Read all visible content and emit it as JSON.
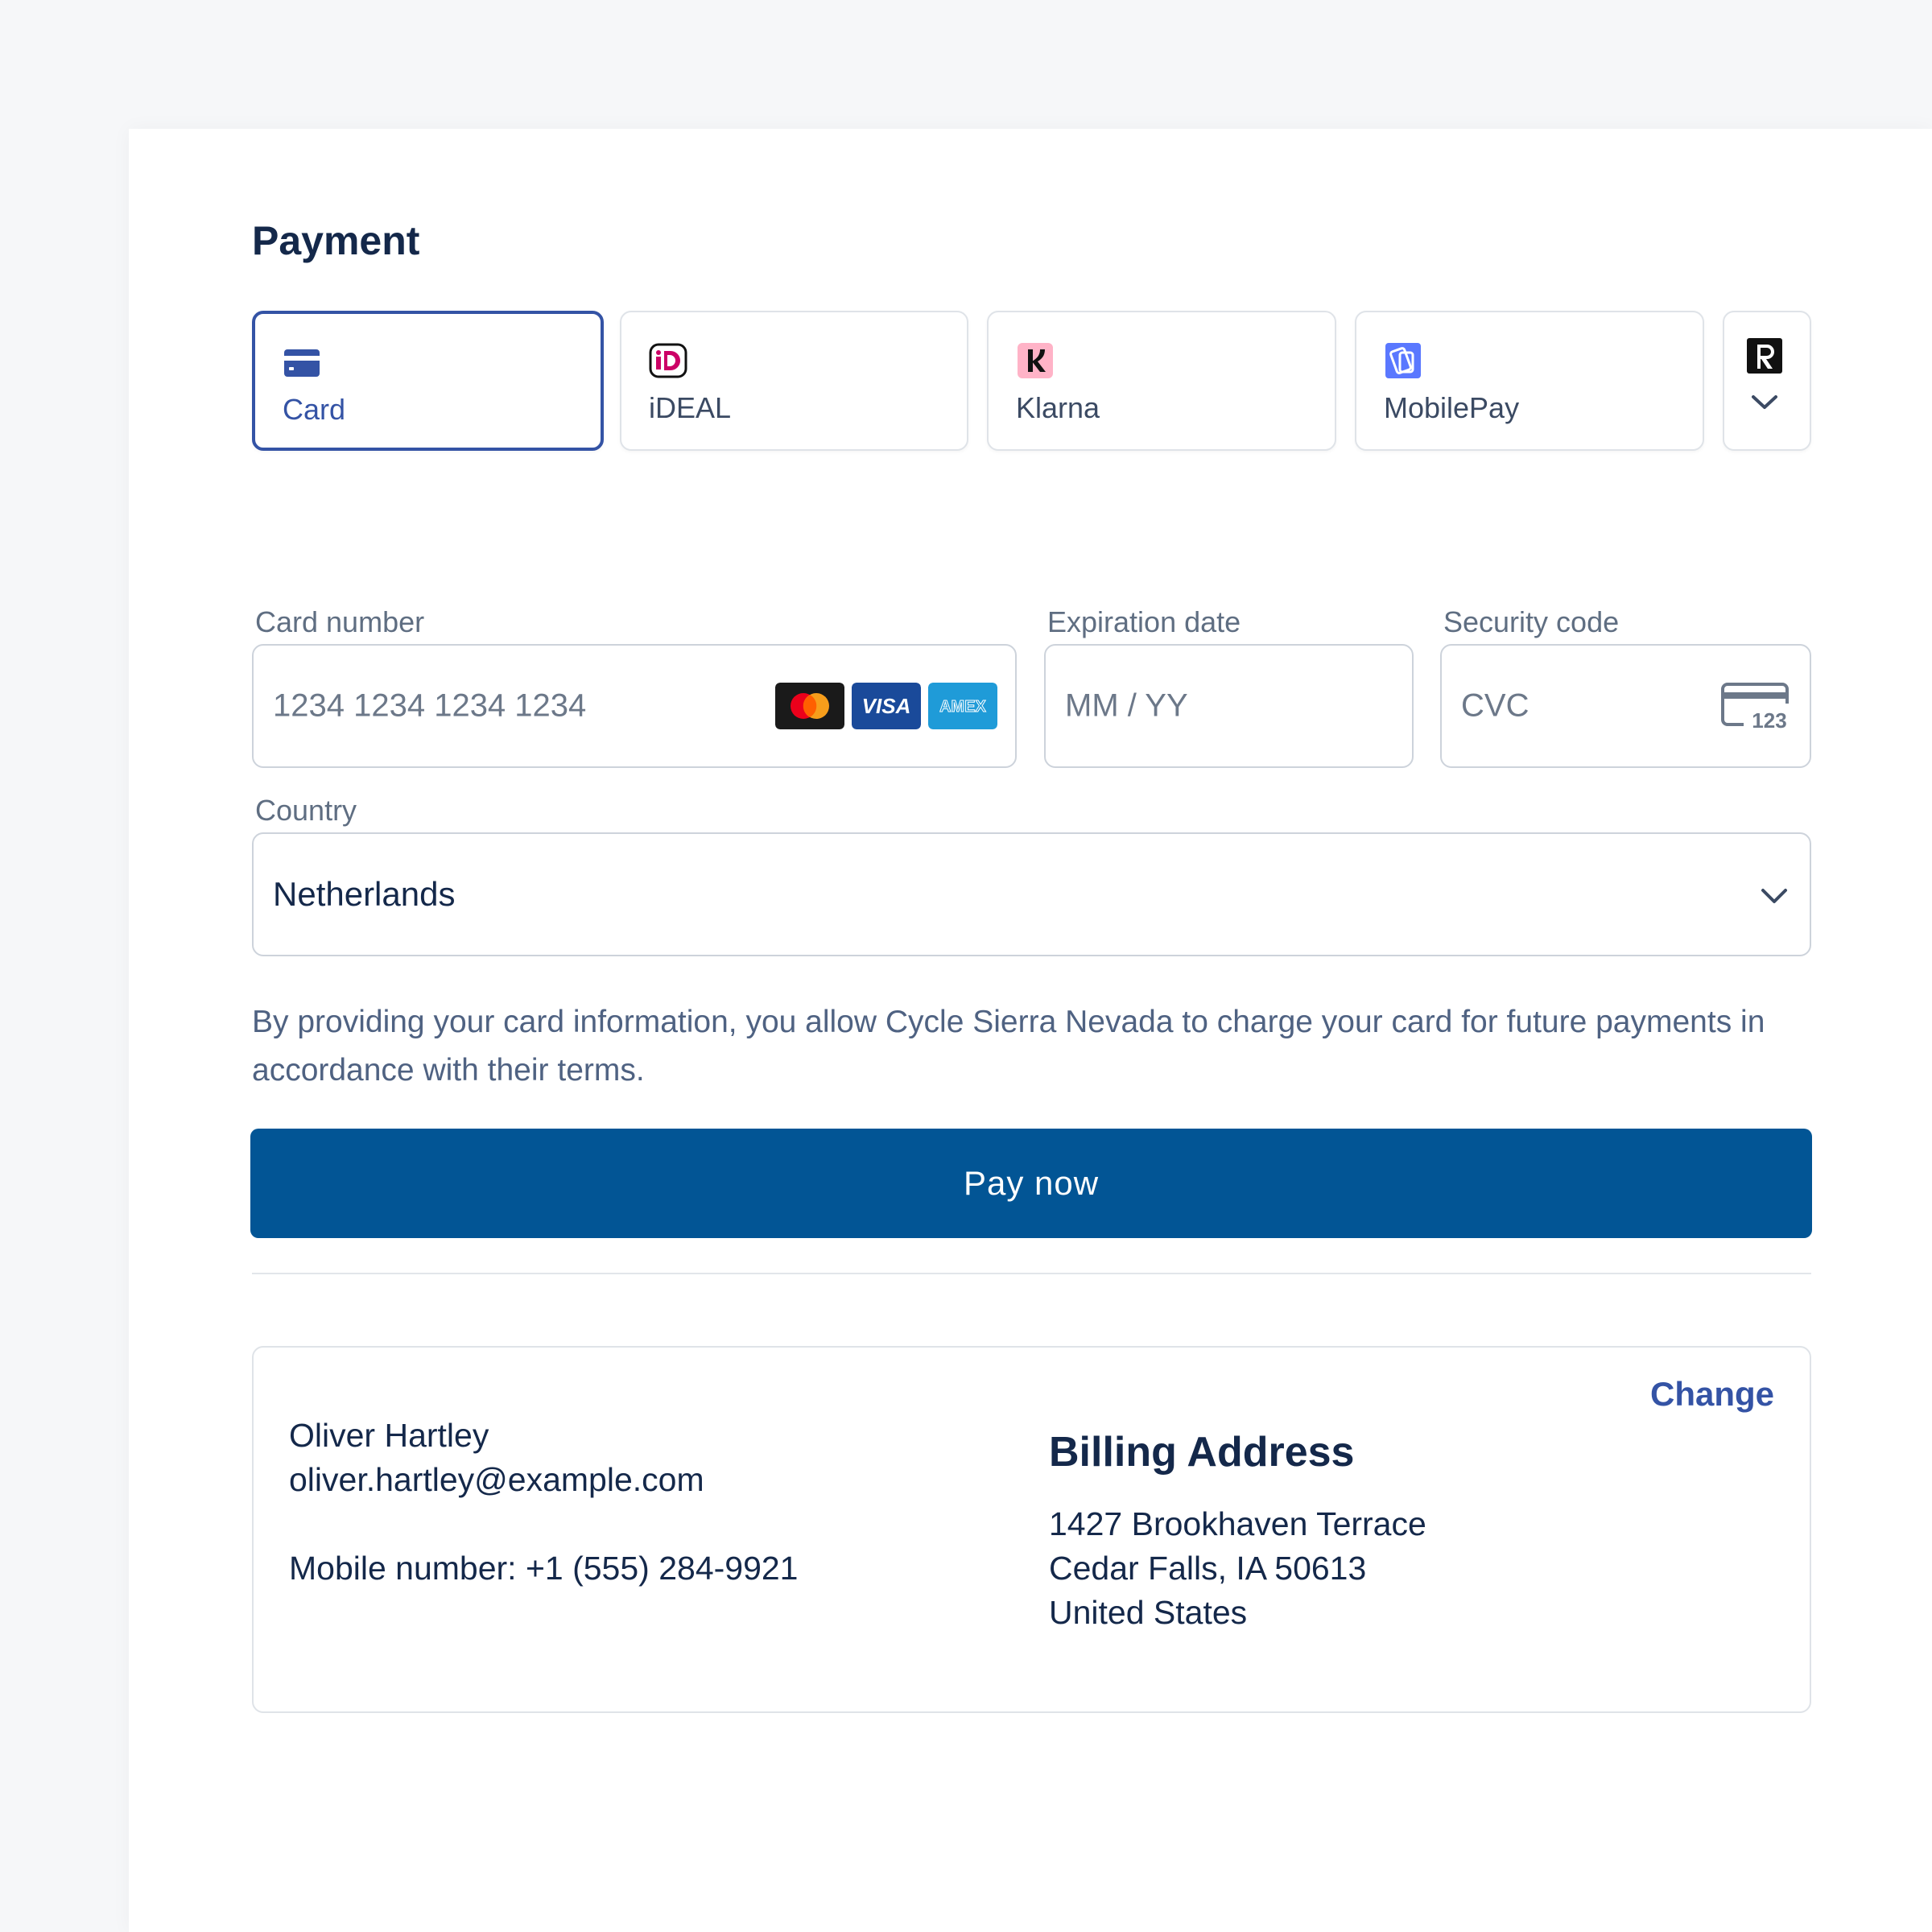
{
  "payment": {
    "title": "Payment",
    "methods": [
      {
        "label": "Card",
        "icon": "card-icon",
        "selected": true
      },
      {
        "label": "iDEAL",
        "icon": "ideal-icon",
        "selected": false
      },
      {
        "label": "Klarna",
        "icon": "klarna-icon",
        "selected": false
      },
      {
        "label": "MobilePay",
        "icon": "mobilepay-icon",
        "selected": false
      },
      {
        "label": "",
        "icon": "revolut-icon",
        "selected": false
      }
    ],
    "more_icon": "chevron-down-icon"
  },
  "form": {
    "card_number": {
      "label": "Card number",
      "placeholder": "1234 1234 1234 1234",
      "brands": [
        "mastercard",
        "visa",
        "amex"
      ]
    },
    "expiration": {
      "label": "Expiration date",
      "placeholder": "MM / YY"
    },
    "security_code": {
      "label": "Security code",
      "placeholder": "CVC",
      "icon_text": "123"
    },
    "country": {
      "label": "Country",
      "value": "Netherlands"
    }
  },
  "brand_labels": {
    "visa": "VISA",
    "amex": "AMEX"
  },
  "notice": "By providing your card information, you allow Cycle Sierra Nevada to charge your card for future payments in accordance with their terms.",
  "pay_button": "Pay now",
  "summary": {
    "name": "Oliver Hartley",
    "email": "oliver.hartley@example.com",
    "mobile": "Mobile number: +1 (555) 284-9921",
    "change_label": "Change",
    "billing_heading": "Billing Address",
    "address_lines": [
      "1427 Brookhaven Terrace",
      "Cedar Falls, IA 50613",
      "United States"
    ]
  },
  "colors": {
    "accent": "#3453a5",
    "button": "#025595",
    "text": "#14284a",
    "muted": "#5f6e82"
  }
}
